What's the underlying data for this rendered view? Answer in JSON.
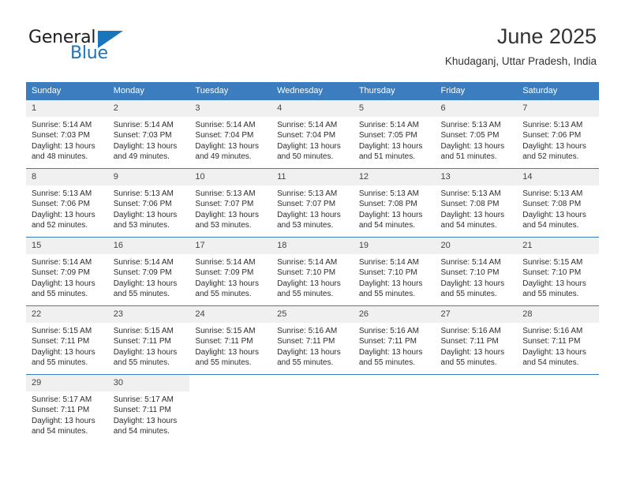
{
  "brand": {
    "name_part1": "General",
    "name_part2": "Blue",
    "accent_color": "#1b75bb"
  },
  "header": {
    "title": "June 2025",
    "subtitle": "Khudaganj, Uttar Pradesh, India"
  },
  "calendar": {
    "header_bg": "#3b7dbf",
    "weekday_headers": [
      "Sunday",
      "Monday",
      "Tuesday",
      "Wednesday",
      "Thursday",
      "Friday",
      "Saturday"
    ],
    "weeks": [
      [
        {
          "day": "1",
          "sunrise": "Sunrise: 5:14 AM",
          "sunset": "Sunset: 7:03 PM",
          "daylight_line1": "Daylight: 13 hours",
          "daylight_line2": "and 48 minutes."
        },
        {
          "day": "2",
          "sunrise": "Sunrise: 5:14 AM",
          "sunset": "Sunset: 7:03 PM",
          "daylight_line1": "Daylight: 13 hours",
          "daylight_line2": "and 49 minutes."
        },
        {
          "day": "3",
          "sunrise": "Sunrise: 5:14 AM",
          "sunset": "Sunset: 7:04 PM",
          "daylight_line1": "Daylight: 13 hours",
          "daylight_line2": "and 49 minutes."
        },
        {
          "day": "4",
          "sunrise": "Sunrise: 5:14 AM",
          "sunset": "Sunset: 7:04 PM",
          "daylight_line1": "Daylight: 13 hours",
          "daylight_line2": "and 50 minutes."
        },
        {
          "day": "5",
          "sunrise": "Sunrise: 5:14 AM",
          "sunset": "Sunset: 7:05 PM",
          "daylight_line1": "Daylight: 13 hours",
          "daylight_line2": "and 51 minutes."
        },
        {
          "day": "6",
          "sunrise": "Sunrise: 5:13 AM",
          "sunset": "Sunset: 7:05 PM",
          "daylight_line1": "Daylight: 13 hours",
          "daylight_line2": "and 51 minutes."
        },
        {
          "day": "7",
          "sunrise": "Sunrise: 5:13 AM",
          "sunset": "Sunset: 7:06 PM",
          "daylight_line1": "Daylight: 13 hours",
          "daylight_line2": "and 52 minutes."
        }
      ],
      [
        {
          "day": "8",
          "sunrise": "Sunrise: 5:13 AM",
          "sunset": "Sunset: 7:06 PM",
          "daylight_line1": "Daylight: 13 hours",
          "daylight_line2": "and 52 minutes."
        },
        {
          "day": "9",
          "sunrise": "Sunrise: 5:13 AM",
          "sunset": "Sunset: 7:06 PM",
          "daylight_line1": "Daylight: 13 hours",
          "daylight_line2": "and 53 minutes."
        },
        {
          "day": "10",
          "sunrise": "Sunrise: 5:13 AM",
          "sunset": "Sunset: 7:07 PM",
          "daylight_line1": "Daylight: 13 hours",
          "daylight_line2": "and 53 minutes."
        },
        {
          "day": "11",
          "sunrise": "Sunrise: 5:13 AM",
          "sunset": "Sunset: 7:07 PM",
          "daylight_line1": "Daylight: 13 hours",
          "daylight_line2": "and 53 minutes."
        },
        {
          "day": "12",
          "sunrise": "Sunrise: 5:13 AM",
          "sunset": "Sunset: 7:08 PM",
          "daylight_line1": "Daylight: 13 hours",
          "daylight_line2": "and 54 minutes."
        },
        {
          "day": "13",
          "sunrise": "Sunrise: 5:13 AM",
          "sunset": "Sunset: 7:08 PM",
          "daylight_line1": "Daylight: 13 hours",
          "daylight_line2": "and 54 minutes."
        },
        {
          "day": "14",
          "sunrise": "Sunrise: 5:13 AM",
          "sunset": "Sunset: 7:08 PM",
          "daylight_line1": "Daylight: 13 hours",
          "daylight_line2": "and 54 minutes."
        }
      ],
      [
        {
          "day": "15",
          "sunrise": "Sunrise: 5:14 AM",
          "sunset": "Sunset: 7:09 PM",
          "daylight_line1": "Daylight: 13 hours",
          "daylight_line2": "and 55 minutes."
        },
        {
          "day": "16",
          "sunrise": "Sunrise: 5:14 AM",
          "sunset": "Sunset: 7:09 PM",
          "daylight_line1": "Daylight: 13 hours",
          "daylight_line2": "and 55 minutes."
        },
        {
          "day": "17",
          "sunrise": "Sunrise: 5:14 AM",
          "sunset": "Sunset: 7:09 PM",
          "daylight_line1": "Daylight: 13 hours",
          "daylight_line2": "and 55 minutes."
        },
        {
          "day": "18",
          "sunrise": "Sunrise: 5:14 AM",
          "sunset": "Sunset: 7:10 PM",
          "daylight_line1": "Daylight: 13 hours",
          "daylight_line2": "and 55 minutes."
        },
        {
          "day": "19",
          "sunrise": "Sunrise: 5:14 AM",
          "sunset": "Sunset: 7:10 PM",
          "daylight_line1": "Daylight: 13 hours",
          "daylight_line2": "and 55 minutes."
        },
        {
          "day": "20",
          "sunrise": "Sunrise: 5:14 AM",
          "sunset": "Sunset: 7:10 PM",
          "daylight_line1": "Daylight: 13 hours",
          "daylight_line2": "and 55 minutes."
        },
        {
          "day": "21",
          "sunrise": "Sunrise: 5:15 AM",
          "sunset": "Sunset: 7:10 PM",
          "daylight_line1": "Daylight: 13 hours",
          "daylight_line2": "and 55 minutes."
        }
      ],
      [
        {
          "day": "22",
          "sunrise": "Sunrise: 5:15 AM",
          "sunset": "Sunset: 7:11 PM",
          "daylight_line1": "Daylight: 13 hours",
          "daylight_line2": "and 55 minutes."
        },
        {
          "day": "23",
          "sunrise": "Sunrise: 5:15 AM",
          "sunset": "Sunset: 7:11 PM",
          "daylight_line1": "Daylight: 13 hours",
          "daylight_line2": "and 55 minutes."
        },
        {
          "day": "24",
          "sunrise": "Sunrise: 5:15 AM",
          "sunset": "Sunset: 7:11 PM",
          "daylight_line1": "Daylight: 13 hours",
          "daylight_line2": "and 55 minutes."
        },
        {
          "day": "25",
          "sunrise": "Sunrise: 5:16 AM",
          "sunset": "Sunset: 7:11 PM",
          "daylight_line1": "Daylight: 13 hours",
          "daylight_line2": "and 55 minutes."
        },
        {
          "day": "26",
          "sunrise": "Sunrise: 5:16 AM",
          "sunset": "Sunset: 7:11 PM",
          "daylight_line1": "Daylight: 13 hours",
          "daylight_line2": "and 55 minutes."
        },
        {
          "day": "27",
          "sunrise": "Sunrise: 5:16 AM",
          "sunset": "Sunset: 7:11 PM",
          "daylight_line1": "Daylight: 13 hours",
          "daylight_line2": "and 55 minutes."
        },
        {
          "day": "28",
          "sunrise": "Sunrise: 5:16 AM",
          "sunset": "Sunset: 7:11 PM",
          "daylight_line1": "Daylight: 13 hours",
          "daylight_line2": "and 54 minutes."
        }
      ],
      [
        {
          "day": "29",
          "sunrise": "Sunrise: 5:17 AM",
          "sunset": "Sunset: 7:11 PM",
          "daylight_line1": "Daylight: 13 hours",
          "daylight_line2": "and 54 minutes."
        },
        {
          "day": "30",
          "sunrise": "Sunrise: 5:17 AM",
          "sunset": "Sunset: 7:11 PM",
          "daylight_line1": "Daylight: 13 hours",
          "daylight_line2": "and 54 minutes."
        },
        {
          "day": "",
          "sunrise": "",
          "sunset": "",
          "daylight_line1": "",
          "daylight_line2": ""
        },
        {
          "day": "",
          "sunrise": "",
          "sunset": "",
          "daylight_line1": "",
          "daylight_line2": ""
        },
        {
          "day": "",
          "sunrise": "",
          "sunset": "",
          "daylight_line1": "",
          "daylight_line2": ""
        },
        {
          "day": "",
          "sunrise": "",
          "sunset": "",
          "daylight_line1": "",
          "daylight_line2": ""
        },
        {
          "day": "",
          "sunrise": "",
          "sunset": "",
          "daylight_line1": "",
          "daylight_line2": ""
        }
      ]
    ]
  }
}
